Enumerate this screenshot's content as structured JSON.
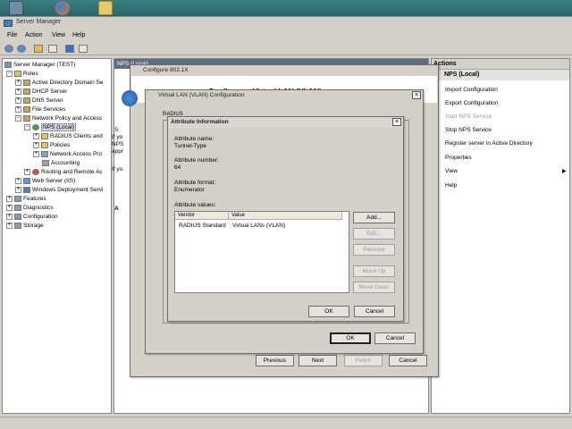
{
  "taskbar": {
    "icons": [
      "server-manager-icon",
      "firefox-icon",
      "folder-icon"
    ]
  },
  "window": {
    "title": "Server Manager"
  },
  "menu": [
    "File",
    "Action",
    "View",
    "Help"
  ],
  "tree": {
    "root": "Server Manager (TEST)",
    "roles": "Roles",
    "items": [
      "Active Directory Domain Se",
      "DHCP Server",
      "DNS Server",
      "File Services",
      "Network Policy and Access",
      "NPS (Local)",
      "RADIUS Clients and",
      "Policies",
      "Network Access Pro",
      "Accounting",
      "Routing and Remote Ac",
      "Web Server (IIS)",
      "Windows Deployment Servi"
    ],
    "features": "Features",
    "diagnostics": "Diagnostics",
    "configuration": "Configuration",
    "storage": "Storage"
  },
  "center": {
    "header": "NPS (Local)",
    "frag_s": "S",
    "frag_ifyo": "If yo",
    "frag_nps": "NPS",
    "frag_appr": "appr",
    "frag_s2": "S",
    "frag_ifyo2": "If yo",
    "frag_f": "F",
    "frag_vl": "VL",
    "frag_te": "Te",
    "frag_n": "N",
    "frag_a": "A"
  },
  "actions": {
    "header": "Actions",
    "sub": "NPS (Local)",
    "items": [
      "Import Configuration",
      "Export Configuration",
      "Start NPS Service",
      "Stop NPS Service",
      "Register server in Active Directory",
      "Properties",
      "View",
      "Help"
    ]
  },
  "wizard": {
    "title": "Configure 802.1X",
    "heading": "Configure a Virtual LAN (VLAN)",
    "buttons": {
      "previous": "Previous",
      "next": "Next",
      "finish": "Finish",
      "cancel": "Cancel"
    }
  },
  "vlan_dialog": {
    "title": "Virtual LAN (VLAN) Configuration",
    "tab_fragment": "RADIUS",
    "ok": "OK",
    "cancel": "Cancel"
  },
  "attr_dialog": {
    "title": "Attribute Information",
    "name_label": "Attribute name:",
    "name_value": "Tunnel-Type",
    "number_label": "Attribute number:",
    "number_value": "64",
    "format_label": "Attribute format:",
    "format_value": "Enumerator",
    "values_label": "Attribute values:",
    "col_vendor": "Vendor",
    "col_value": "Value",
    "rows": [
      {
        "vendor": "RADIUS Standard",
        "value": "Virtual LANs (VLAN)"
      }
    ],
    "add": "Add...",
    "edit": "Edit...",
    "remove": "Remove",
    "move_up": "Move Up",
    "move_down": "Move Down",
    "ok": "OK",
    "cancel": "Cancel"
  }
}
